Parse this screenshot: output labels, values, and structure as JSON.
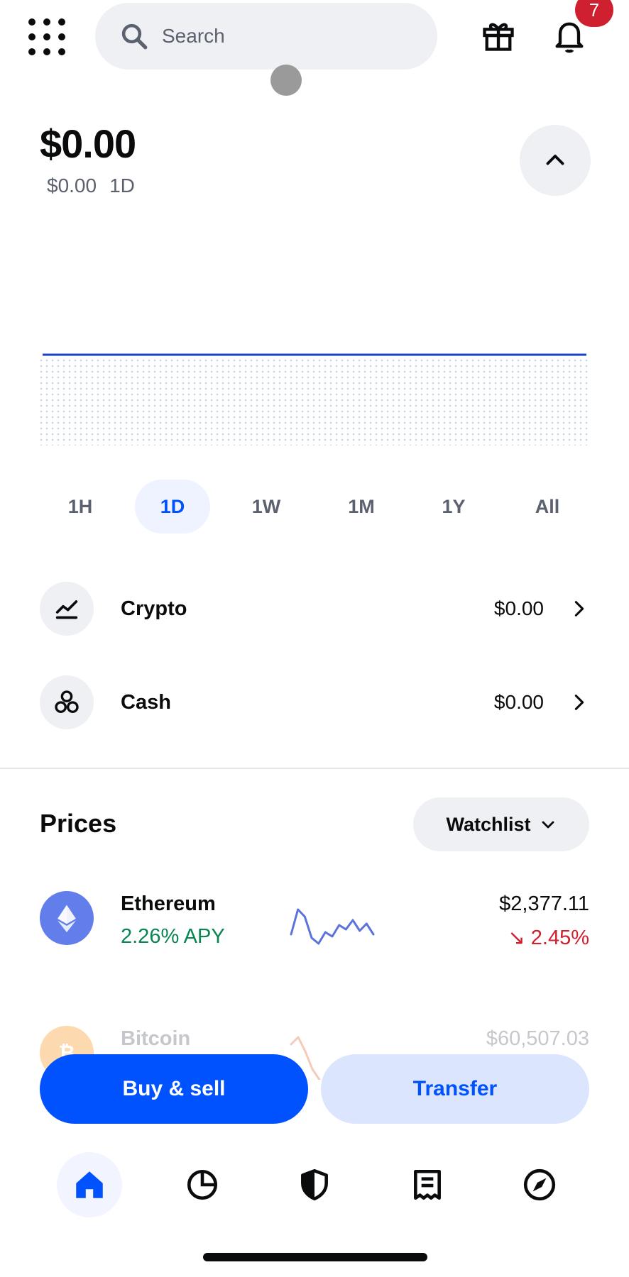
{
  "header": {
    "search_placeholder": "Search",
    "notification_count": "7"
  },
  "balance": {
    "total": "$0.00",
    "change": "$0.00",
    "period": "1D"
  },
  "chart_data": {
    "type": "area",
    "x": [
      "start",
      "end"
    ],
    "values": [
      0,
      0
    ],
    "title": "",
    "xlabel": "",
    "ylabel": "",
    "line_color": "#1a40c8",
    "fill": "dotted"
  },
  "timeframes": [
    {
      "label": "1H",
      "active": false
    },
    {
      "label": "1D",
      "active": true
    },
    {
      "label": "1W",
      "active": false
    },
    {
      "label": "1M",
      "active": false
    },
    {
      "label": "1Y",
      "active": false
    },
    {
      "label": "All",
      "active": false
    }
  ],
  "assets": [
    {
      "label": "Crypto",
      "value": "$0.00",
      "icon": "chart-line-icon"
    },
    {
      "label": "Cash",
      "value": "$0.00",
      "icon": "coins-icon"
    }
  ],
  "prices": {
    "title": "Prices",
    "filter_label": "Watchlist",
    "coins": [
      {
        "name": "Ethereum",
        "sub": "2.26% APY",
        "price": "$2,377.11",
        "change": "↘ 2.45%",
        "color": "#627eea",
        "spark": [
          55,
          20,
          30,
          60,
          68,
          52,
          58,
          42,
          48,
          35,
          50,
          40,
          55
        ]
      },
      {
        "name": "Bitcoin",
        "sub": "",
        "price": "$60,507.03",
        "change": "",
        "color": "#f7931a",
        "spark": [
          20,
          10,
          30,
          55,
          70
        ]
      }
    ]
  },
  "actions": {
    "buy_sell": "Buy & sell",
    "transfer": "Transfer"
  },
  "colors": {
    "primary": "#0052ff",
    "negative": "#cf202f",
    "positive": "#098551"
  }
}
